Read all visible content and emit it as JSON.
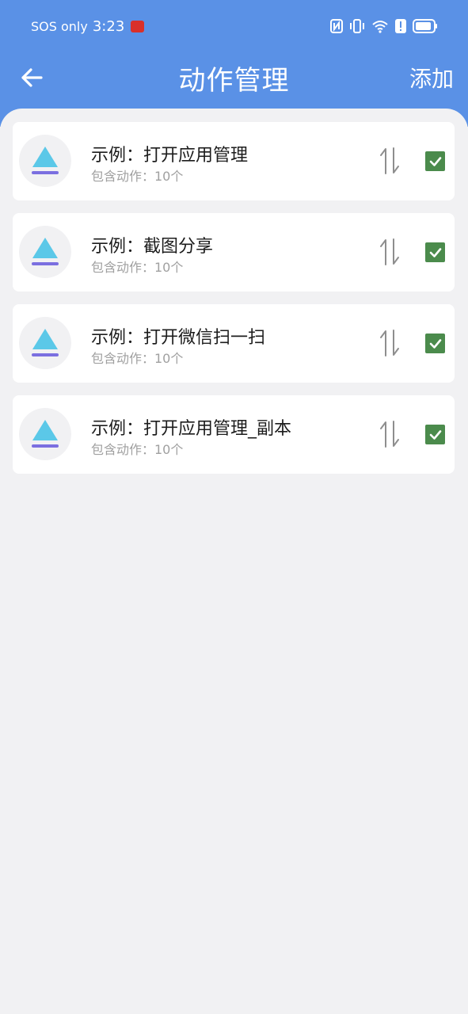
{
  "status_bar": {
    "carrier": "SOS only",
    "time": "3:23",
    "icons": [
      "nfc-icon",
      "vibrate-icon",
      "wifi-icon",
      "alert-icon",
      "battery-icon"
    ]
  },
  "appbar": {
    "title": "动作管理",
    "add_label": "添加",
    "back_icon": "arrow-left-icon"
  },
  "colors": {
    "header_bg": "#5a91e6",
    "page_bg": "#f1f1f3",
    "checkbox": "#4b8b4c",
    "icon_triangle": "#5bc8e8",
    "icon_bar": "#7b6fe0"
  },
  "items": [
    {
      "title": "示例：打开应用管理",
      "subtitle": "包含动作：10个",
      "checked": true
    },
    {
      "title": "示例：截图分享",
      "subtitle": "包含动作：10个",
      "checked": true
    },
    {
      "title": "示例：打开微信扫一扫",
      "subtitle": "包含动作：10个",
      "checked": true
    },
    {
      "title": "示例：打开应用管理_副本",
      "subtitle": "包含动作：10个",
      "checked": true
    }
  ]
}
